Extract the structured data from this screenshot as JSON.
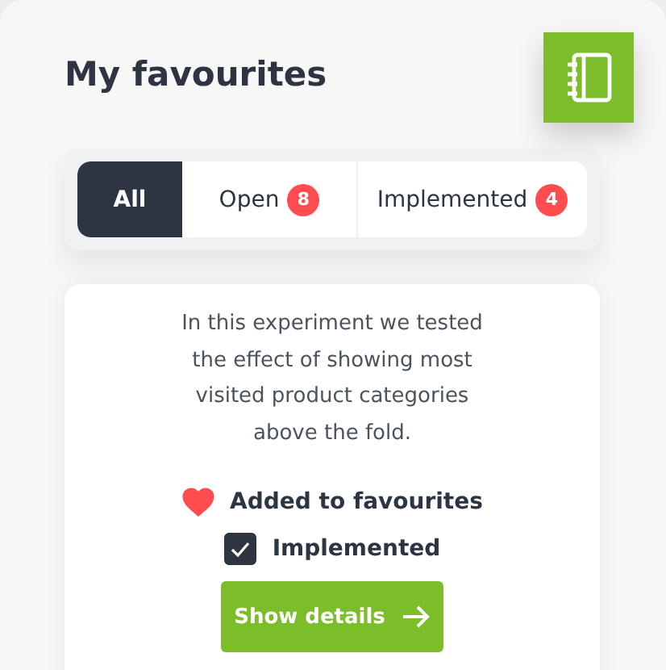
{
  "header": {
    "title": "My favourites"
  },
  "tabs": [
    {
      "label": "All",
      "selected": true
    },
    {
      "label": "Open",
      "count": "8",
      "selected": false
    },
    {
      "label": "Implemented",
      "count": "4",
      "selected": false
    }
  ],
  "card": {
    "description": "In this experiment we tested the effect of showing most visited product categories above the fold.",
    "favourite": {
      "label": "Added to favourites",
      "on": true
    },
    "implemented": {
      "label": "Implemented",
      "checked": true
    },
    "button": "Show details"
  }
}
